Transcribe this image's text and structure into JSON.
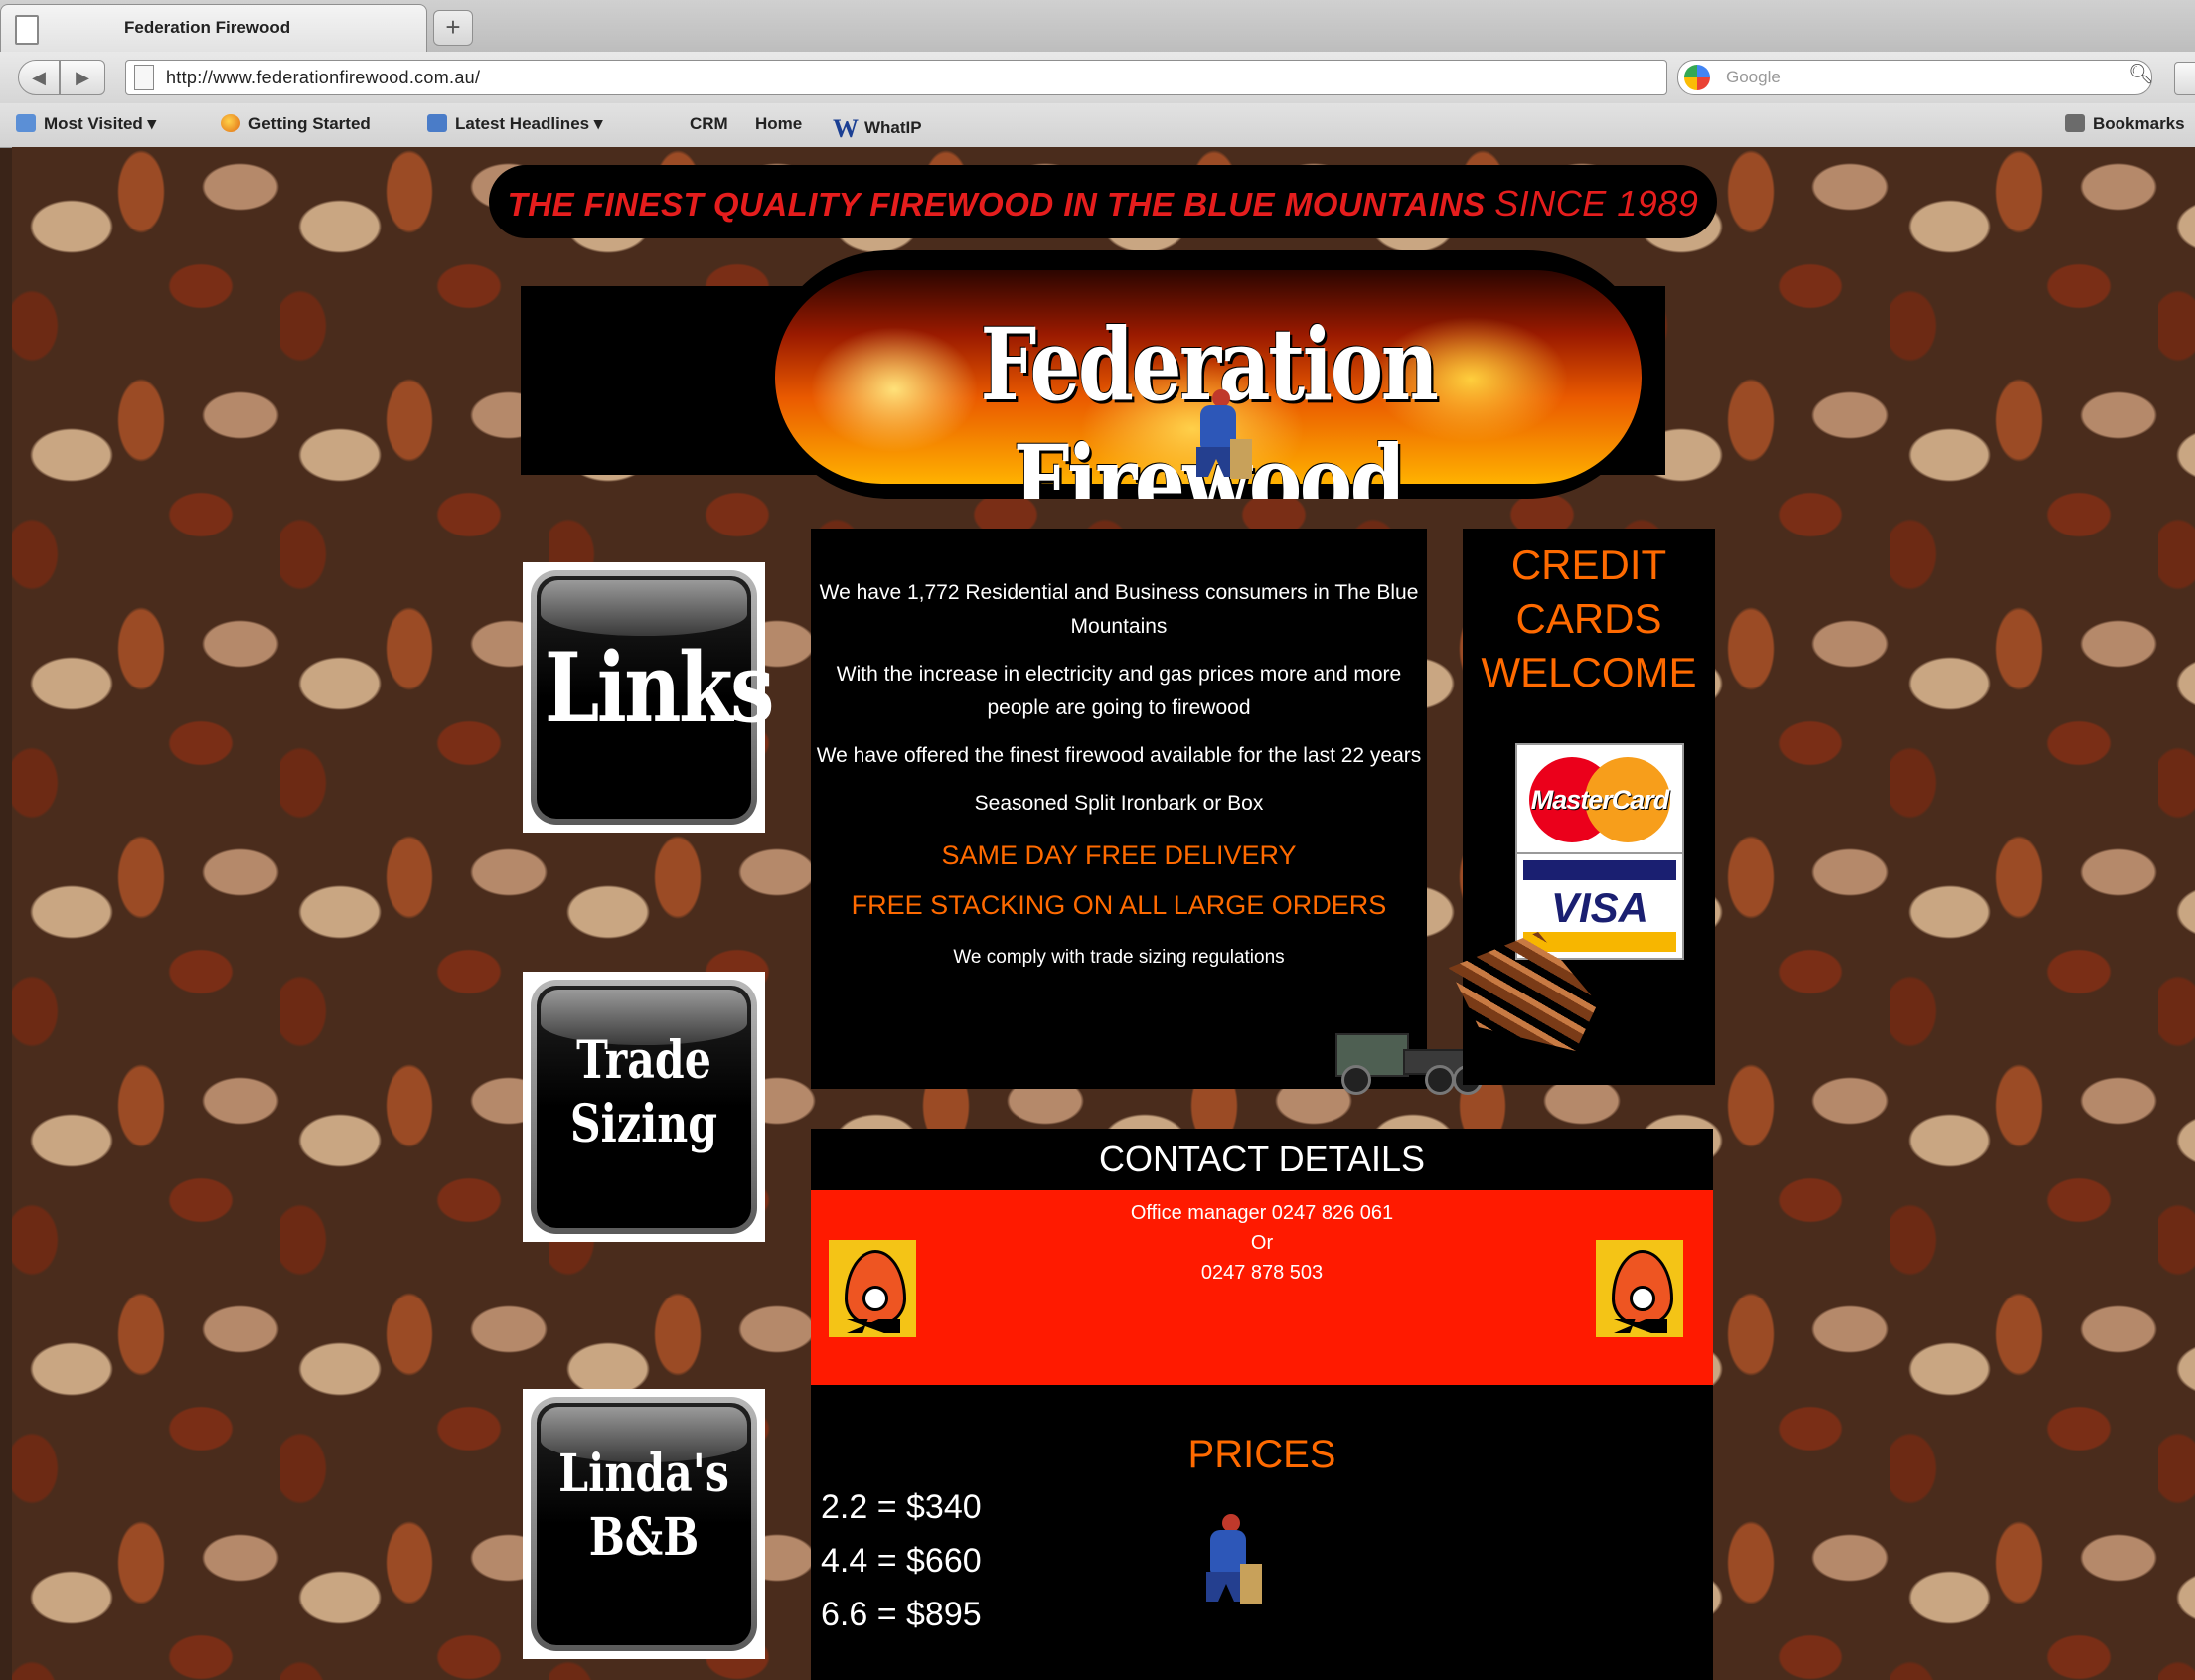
{
  "browser": {
    "tab_title": "Federation Firewood",
    "new_tab": "+",
    "url": "http://www.federationfirewood.com.au/",
    "search_placeholder": "Google",
    "bookmarks": [
      "Most Visited ▾",
      "Getting Started",
      "Latest Headlines ▾",
      "CRM",
      "Home",
      "WhatIP"
    ],
    "bookmarks_right": "Bookmarks",
    "icons": {
      "back": "back-arrow-icon",
      "forward": "forward-arrow-icon",
      "star": "star-icon",
      "reload": "reload-icon",
      "search": "search-icon"
    }
  },
  "page": {
    "tagline_main": "THE FINEST QUALITY FIREWOOD IN THE BLUE MOUNTAINS",
    "tagline_since": "SINCE 1989",
    "logo_title": "Federation Firewood",
    "nav": {
      "links_label": "Links",
      "trade_label": "Trade Sizing",
      "linda_label": "Linda's B&B"
    },
    "info": {
      "p1": "We have 1,772 Residential and Business consumers in The Blue Mountains",
      "p2": "With the increase in electricity and gas prices more and more people are going to firewood",
      "p3": "We have offered the finest firewood available for the last 22 years",
      "p4": "Seasoned Split Ironbark or Box",
      "p5": "SAME DAY FREE DELIVERY",
      "p6": "FREE STACKING ON ALL LARGE ORDERS",
      "p7": "We comply with trade sizing regulations"
    },
    "cards": {
      "title": "CREDIT CARDS WELCOME",
      "mastercard": "MasterCard",
      "visa": "VISA"
    },
    "contact": {
      "header": "CONTACT DETAILS",
      "line1": "Office manager 0247 826 061",
      "line2": "Or",
      "line3": "0247 878 503"
    },
    "prices": {
      "title": "PRICES",
      "items": [
        "2.2 = $340",
        "4.4 = $660",
        "6.6 = $895"
      ]
    },
    "colors": {
      "tagline_red": "#e51d1d",
      "accent_orange": "#ff6a00",
      "contact_red": "#ff1a00",
      "panel_black": "#000000"
    }
  }
}
